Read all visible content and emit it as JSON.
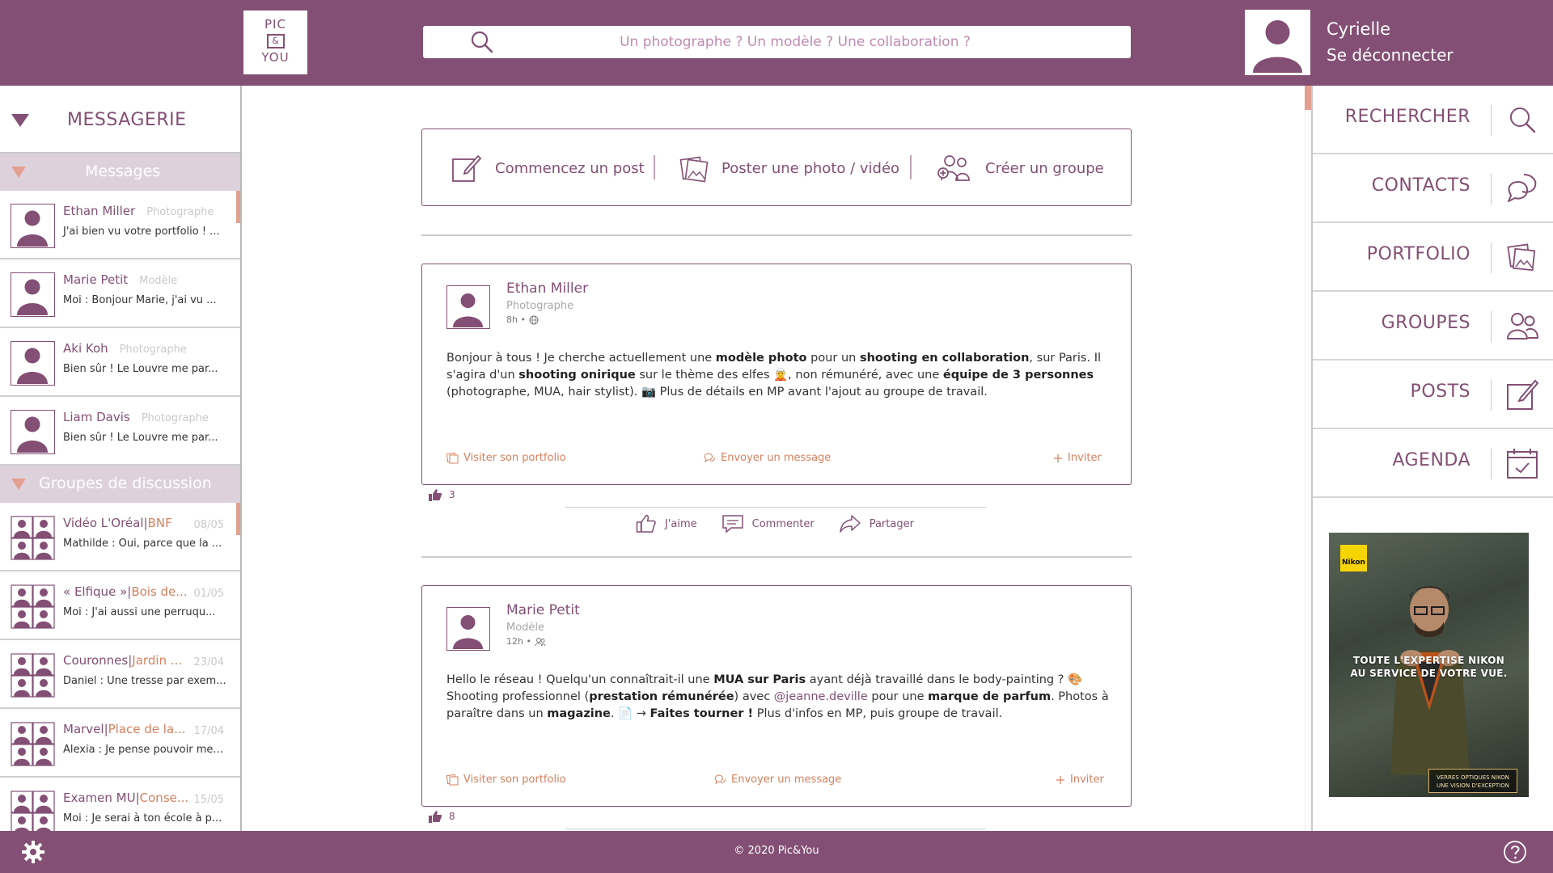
{
  "header": {
    "logo": {
      "line1": "PIC",
      "line2": "&",
      "line3": "YOU"
    },
    "search_placeholder": "Un photographe ? Un modèle ? Une collaboration ?",
    "user_name": "Cyrielle",
    "logout_label": "Se déconnecter"
  },
  "sidebar": {
    "title": "MESSAGERIE",
    "messages_title": "Messages",
    "messages": [
      {
        "name": "Ethan Miller",
        "role": "Photographe",
        "preview": "J'ai bien vu votre portfolio ! ..."
      },
      {
        "name": "Marie Petit",
        "role": "Modèle",
        "preview": "Moi : Bonjour Marie, j'ai vu ..."
      },
      {
        "name": "Aki Koh",
        "role": "Photographe",
        "preview": "Bien sûr ! Le Louvre me par..."
      },
      {
        "name": "Liam Davis",
        "role": "Photographe",
        "preview": "Bien sûr ! Le Louvre me par..."
      }
    ],
    "groups_title": "Groupes de discussion",
    "groups": [
      {
        "name": "Vidéo L'Oréal",
        "place": "BNF",
        "date": "08/05",
        "preview": "Mathilde : Oui, parce que la ..."
      },
      {
        "name": "« Elfique »",
        "place": "Bois de...",
        "date": "01/05",
        "preview": "Moi : J'ai aussi une perruqu..."
      },
      {
        "name": "Couronnes",
        "place": "Jardin ...",
        "date": "23/04",
        "preview": "Daniel : Une tresse par exem..."
      },
      {
        "name": "Marvel",
        "place": "Place de la...",
        "date": "17/04",
        "preview": "Alexia : Je pense pouvoir me..."
      },
      {
        "name": "Examen MU",
        "place": "Conse...",
        "date": "15/05",
        "preview": "Moi : Je serai à ton école à p..."
      }
    ]
  },
  "composer": {
    "start_post": "Commencez un post",
    "post_media": "Poster une photo / vidéo",
    "create_group": "Créer un groupe"
  },
  "posts": [
    {
      "author": "Ethan Miller",
      "role": "Photographe",
      "time": "8h •",
      "audience_icon": "globe-icon",
      "body": [
        {
          "t": "Bonjour à tous ! Je cherche actuellement une "
        },
        {
          "t": "modèle photo",
          "b": true
        },
        {
          "t": " pour un "
        },
        {
          "t": "shooting en collaboration",
          "b": true
        },
        {
          "t": ", sur Paris. Il s'agira d'un "
        },
        {
          "t": "shooting onirique",
          "b": true
        },
        {
          "t": " sur le thème des elfes 🧝, non rémunéré, avec une "
        },
        {
          "t": "équipe de 3 personnes",
          "b": true
        },
        {
          "t": " (photographe, MUA, hair stylist). 📷 Plus de détails en MP avant l'ajout au groupe de travail."
        }
      ],
      "actions": {
        "portfolio": "Visiter son portfolio",
        "message": "Envoyer un message",
        "invite": "Inviter"
      },
      "likes": "3"
    },
    {
      "author": "Marie Petit",
      "role": "Modèle",
      "time": "12h •",
      "audience_icon": "friends-icon",
      "body": [
        {
          "t": "Hello le réseau ! Quelqu'un connaîtrait-il une "
        },
        {
          "t": "MUA sur Paris",
          "b": true
        },
        {
          "t": " ayant déjà travaillé dans le body-painting ? 🎨 Shooting professionnel ("
        },
        {
          "t": "prestation rémunérée",
          "b": true
        },
        {
          "t": ") avec "
        },
        {
          "t": "@jeanne.deville",
          "m": true
        },
        {
          "t": " pour une "
        },
        {
          "t": "marque de parfum",
          "b": true
        },
        {
          "t": ". Photos à paraître dans un "
        },
        {
          "t": "magazine",
          "b": true
        },
        {
          "t": ". 📄 → "
        },
        {
          "t": "Faites tourner !",
          "b": true
        },
        {
          "t": " Plus d'infos en MP, puis groupe de travail."
        }
      ],
      "actions": {
        "portfolio": "Visiter son portfolio",
        "message": "Envoyer un message",
        "invite": "Inviter"
      },
      "likes": "8"
    }
  ],
  "reactions": {
    "like": "J'aime",
    "comment": "Commenter",
    "share": "Partager"
  },
  "right_nav": [
    {
      "label": "RECHERCHER",
      "icon": "search-icon"
    },
    {
      "label": "CONTACTS",
      "icon": "chat-bubbles-icon"
    },
    {
      "label": "PORTFOLIO",
      "icon": "photos-icon"
    },
    {
      "label": "GROUPES",
      "icon": "group-icon"
    },
    {
      "label": "POSTS",
      "icon": "edit-icon"
    },
    {
      "label": "AGENDA",
      "icon": "calendar-icon"
    }
  ],
  "ad": {
    "brand": "Nikon",
    "tagline_1": "TOUTE L'EXPERTISE NIKON",
    "tagline_2": "AU SERVICE DE VOTRE VUE.",
    "bottom_1": "VERRES OPTIQUES NIKON",
    "bottom_2": "UNE VISION D'EXCEPTION"
  },
  "footer": {
    "copyright": "© 2020 Pic&You"
  },
  "colors": {
    "brand": "#834f74",
    "accent": "#d5805f",
    "section_bg": "#ddd1dc"
  }
}
